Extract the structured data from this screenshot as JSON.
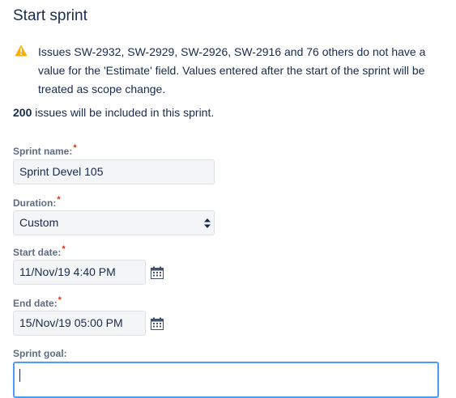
{
  "dialog": {
    "title": "Start sprint",
    "warning": "Issues SW-2932, SW-2929, SW-2926, SW-2916 and 76 others do not have a value for the 'Estimate' field. Values entered after the start of the sprint will be treated as scope change.",
    "issue_count": "200",
    "issue_count_text": " issues will be included in this sprint."
  },
  "form": {
    "sprint_name": {
      "label": "Sprint name:",
      "value": "Sprint Devel 105"
    },
    "duration": {
      "label": "Duration:",
      "value": "Custom"
    },
    "start_date": {
      "label": "Start date:",
      "value": "11/Nov/19 4:40 PM"
    },
    "end_date": {
      "label": "End date:",
      "value": "15/Nov/19 05:00 PM"
    },
    "sprint_goal": {
      "label": "Sprint goal:",
      "value": ""
    },
    "required_mark": "*"
  },
  "icons": {
    "warning": "warning-icon",
    "calendar": "calendar-icon",
    "select": "select-arrows-icon"
  },
  "colors": {
    "warning": "#ffab00",
    "focus": "#4c9aff",
    "required": "#de350b"
  }
}
